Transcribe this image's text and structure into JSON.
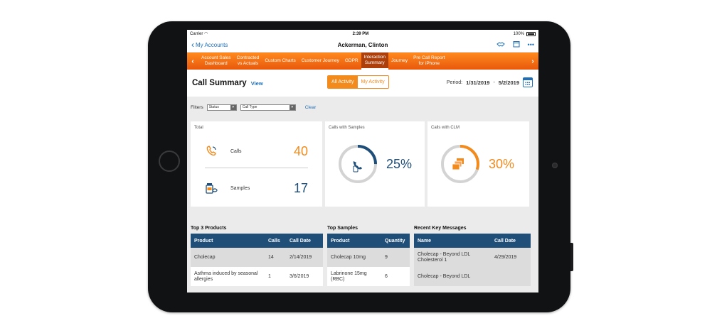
{
  "status_bar": {
    "carrier": "Carrier",
    "time": "2:39 PM",
    "battery": "100%"
  },
  "nav": {
    "back_label": "My Accounts",
    "title": "Ackerman, Clinton",
    "more_label": "•••"
  },
  "tabs": [
    {
      "label": "Account Sales\nDashboard",
      "active": false
    },
    {
      "label": "Contracted\nvs Actuals",
      "active": false
    },
    {
      "label": "Custom Charts",
      "active": false
    },
    {
      "label": "Customer Journey",
      "active": false
    },
    {
      "label": "GDPR",
      "active": false
    },
    {
      "label": "Interaction\nSummary",
      "active": true
    },
    {
      "label": "Journey",
      "active": false
    },
    {
      "label": "Pre Call Report\nfor iPhone",
      "active": false
    }
  ],
  "summary": {
    "title": "Call Summary",
    "view_link": "View",
    "segments": {
      "all": "All Activity",
      "mine": "My Activity",
      "selected": "All Activity"
    },
    "period_label": "Period:",
    "period_start": "1/31/2019",
    "period_sep": "-",
    "period_end": "5/2/2019"
  },
  "filters": {
    "label": "Filters",
    "status_select": "Status",
    "call_type_select": "Call Type",
    "clear_label": "Clear"
  },
  "cards": {
    "total": {
      "title": "Total",
      "calls_label": "Calls",
      "calls_value": "40",
      "samples_label": "Samples",
      "samples_value": "17"
    },
    "samples": {
      "title": "Calls with Samples",
      "percent_label": "25%",
      "percent": 25
    },
    "clm": {
      "title": "Calls with CLM",
      "percent_label": "30%",
      "percent": 30
    }
  },
  "colors": {
    "orange": "#f28a1c",
    "navy": "#1f4e79",
    "blue": "#1f6fb8",
    "gray_ring": "#d3d3d3"
  },
  "tables": {
    "products": {
      "title": "Top 3 Products",
      "headers": [
        "Product",
        "Calls",
        "Call Date"
      ],
      "rows": [
        [
          "Cholecap",
          "14",
          "2/14/2019"
        ],
        [
          "Asthma induced by seasonal allergies",
          "1",
          "3/6/2019"
        ]
      ]
    },
    "samples": {
      "title": "Top Samples",
      "headers": [
        "Product",
        "Quantity"
      ],
      "rows": [
        [
          "Cholecap 10mg",
          "9"
        ],
        [
          "Labrinone 15mg (RBC)",
          "6"
        ]
      ]
    },
    "messages": {
      "title": "Recent Key Messages",
      "headers": [
        "Name",
        "Call Date"
      ],
      "rows": [
        [
          "Cholecap - Beyond LDL Cholesterol 1",
          "4/29/2019"
        ],
        [
          "Cholecap - Beyond LDL",
          ""
        ]
      ]
    }
  }
}
